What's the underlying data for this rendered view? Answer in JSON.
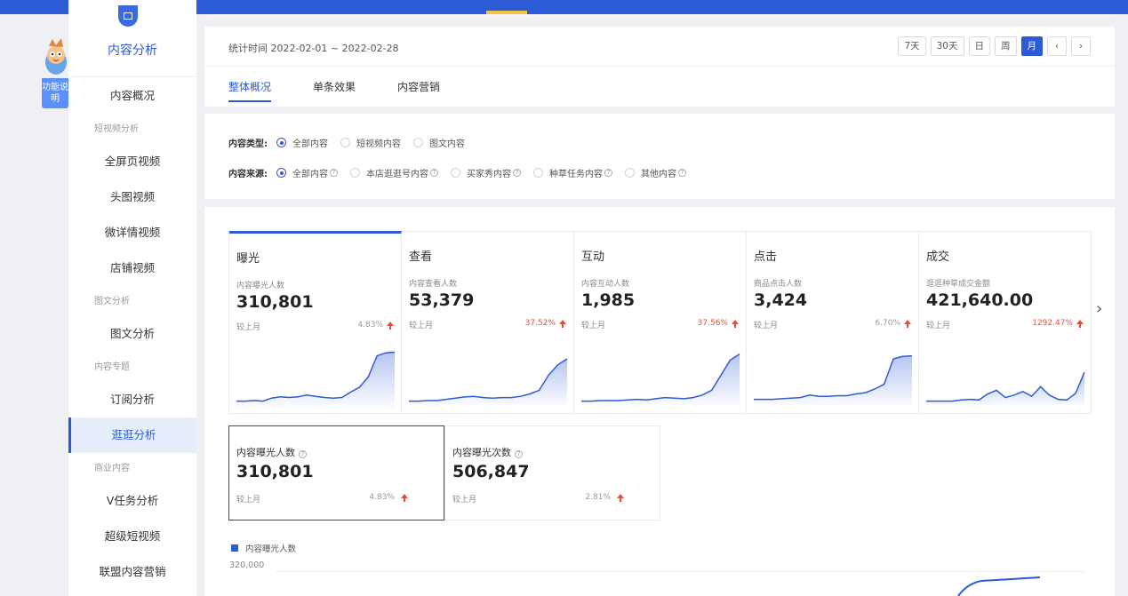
{
  "helper": {
    "label": "功能说明"
  },
  "sidebar": {
    "title": "内容分析",
    "items": [
      {
        "type": "item",
        "label": "内容概况"
      },
      {
        "type": "group",
        "label": "短视频分析"
      },
      {
        "type": "item",
        "label": "全屏页视频"
      },
      {
        "type": "item",
        "label": "头图视频"
      },
      {
        "type": "item",
        "label": "微详情视频"
      },
      {
        "type": "item",
        "label": "店铺视频"
      },
      {
        "type": "group",
        "label": "图文分析"
      },
      {
        "type": "item",
        "label": "图文分析"
      },
      {
        "type": "group",
        "label": "内容专题"
      },
      {
        "type": "item",
        "label": "订阅分析"
      },
      {
        "type": "item",
        "label": "逛逛分析",
        "active": true
      },
      {
        "type": "group",
        "label": "商业内容"
      },
      {
        "type": "item",
        "label": "V任务分析"
      },
      {
        "type": "item",
        "label": "超级短视频"
      },
      {
        "type": "item",
        "label": "联盟内容营销"
      }
    ]
  },
  "header": {
    "date_range": "统计时间 2022-02-01 ~ 2022-02-28",
    "date_buttons": [
      "7天",
      "30天",
      "日",
      "周",
      "月",
      "‹",
      "›"
    ],
    "active_date_button": "月",
    "tabs": [
      "整体概况",
      "单条效果",
      "内容营销"
    ],
    "active_tab": "整体概况"
  },
  "filters": {
    "type_label": "内容类型:",
    "type_options": [
      "全部内容",
      "短视频内容",
      "图文内容"
    ],
    "source_label": "内容来源:",
    "source_options": [
      "全部内容",
      "本店逛逛号内容",
      "买家秀内容",
      "种草任务内容",
      "其他内容"
    ]
  },
  "metrics": [
    {
      "title": "曝光",
      "sub": "内容曝光人数",
      "value": "310,801",
      "cmp": "较上月",
      "pct": "4.83%",
      "trend": [
        0.05,
        0.05,
        0.06,
        0.05,
        0.1,
        0.12,
        0.11,
        0.12,
        0.15,
        0.13,
        0.11,
        0.1,
        0.11,
        0.2,
        0.28,
        0.45,
        0.8,
        0.85,
        0.86
      ]
    },
    {
      "title": "查看",
      "sub": "内容查看人数",
      "value": "53,379",
      "cmp": "较上月",
      "pct": "37.52%",
      "trend": [
        0.02,
        0.02,
        0.03,
        0.03,
        0.05,
        0.07,
        0.09,
        0.1,
        0.08,
        0.07,
        0.08,
        0.08,
        0.1,
        0.14,
        0.2,
        0.45,
        0.62,
        0.72
      ]
    },
    {
      "title": "互动",
      "sub": "内容互动人数",
      "value": "1,985",
      "cmp": "较上月",
      "pct": "37.56%",
      "trend": [
        0.02,
        0.02,
        0.03,
        0.03,
        0.03,
        0.04,
        0.05,
        0.04,
        0.06,
        0.08,
        0.07,
        0.06,
        0.08,
        0.12,
        0.2,
        0.45,
        0.7,
        0.8
      ]
    },
    {
      "title": "点击",
      "sub": "商品点击人数",
      "value": "3,424",
      "cmp": "较上月",
      "pct": "6.70%",
      "trend": [
        0.05,
        0.05,
        0.05,
        0.06,
        0.07,
        0.08,
        0.12,
        0.1,
        0.1,
        0.11,
        0.11,
        0.14,
        0.16,
        0.22,
        0.3,
        0.72,
        0.76,
        0.77
      ]
    },
    {
      "title": "成交",
      "sub": "逛逛种草成交金额",
      "value": "421,640.00",
      "cmp": "较上月",
      "pct": "1292.47%",
      "trend": [
        0.02,
        0.02,
        0.02,
        0.02,
        0.04,
        0.05,
        0.04,
        0.14,
        0.2,
        0.08,
        0.12,
        0.18,
        0.1,
        0.26,
        0.12,
        0.05,
        0.04,
        0.15,
        0.5
      ]
    }
  ],
  "subcards": [
    {
      "title": "内容曝光人数",
      "value": "310,801",
      "cmp": "较上月",
      "pct": "4.83%"
    },
    {
      "title": "内容曝光次数",
      "value": "506,847",
      "cmp": "较上月",
      "pct": "2.81%"
    }
  ],
  "chart": {
    "legend": "内容曝光人数",
    "ytick": "320,000"
  },
  "colors": {
    "accent": "#2d5bd6",
    "up": "#e34d3d"
  }
}
